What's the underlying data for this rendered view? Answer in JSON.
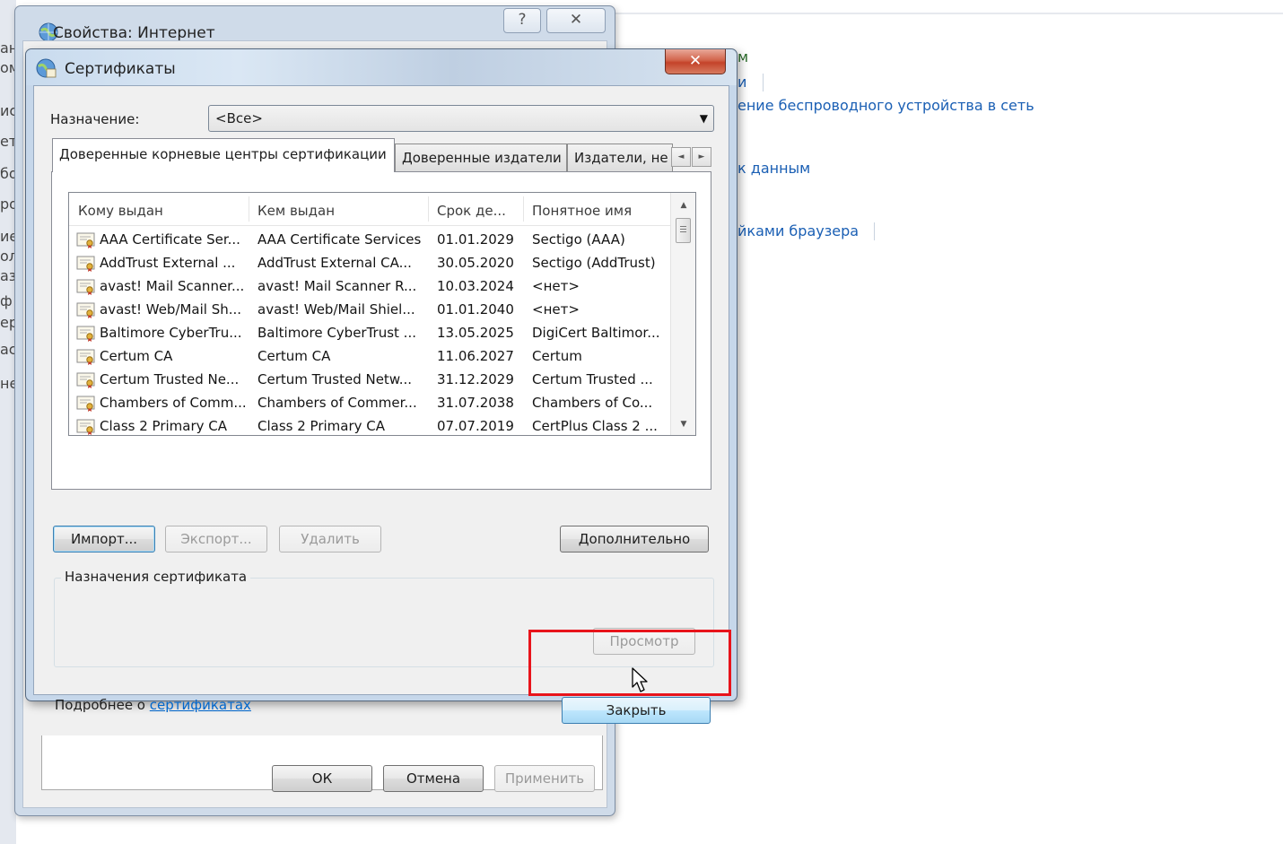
{
  "background": {
    "links": [
      "ение беспроводного устройства в сеть",
      "к данным",
      "йками браузера"
    ],
    "fragments": [
      "м",
      "и"
    ],
    "left_fragments": [
      "ан",
      "ом",
      "ис",
      "ети",
      "бо",
      "ро",
      "ие",
      "ол",
      "аз",
      "ф",
      "ерт",
      "ас",
      "не"
    ]
  },
  "internet_options": {
    "title": "Свойства: Интернет",
    "help_btn": "?",
    "close_btn": "✕",
    "buttons": {
      "ok": "ОК",
      "cancel": "Отмена",
      "apply": "Применить"
    }
  },
  "certificates_dialog": {
    "title": "Сертификаты",
    "close_btn": "✕",
    "purpose_label": "Назначение:",
    "purpose_value": "<Все>",
    "tabs": [
      "Доверенные корневые центры сертификации",
      "Доверенные издатели",
      "Издатели, не"
    ],
    "tab_scroll_left": "◄",
    "tab_scroll_right": "►",
    "columns": [
      "Кому выдан",
      "Кем выдан",
      "Срок де...",
      "Понятное имя"
    ],
    "rows": [
      [
        "AAA Certificate Ser...",
        "AAA Certificate Services",
        "01.01.2029",
        "Sectigo (AAA)"
      ],
      [
        "AddTrust External ...",
        "AddTrust External CA...",
        "30.05.2020",
        "Sectigo (AddTrust)"
      ],
      [
        "avast! Mail Scanner...",
        "avast! Mail Scanner R...",
        "10.03.2024",
        "<нет>"
      ],
      [
        "avast! Web/Mail Sh...",
        "avast! Web/Mail Shiel...",
        "01.01.2040",
        "<нет>"
      ],
      [
        "Baltimore CyberTru...",
        "Baltimore CyberTrust ...",
        "13.05.2025",
        "DigiCert Baltimor..."
      ],
      [
        "Certum CA",
        "Certum CA",
        "11.06.2027",
        "Certum"
      ],
      [
        "Certum Trusted Ne...",
        "Certum Trusted Netw...",
        "31.12.2029",
        "Certum Trusted ..."
      ],
      [
        "Chambers of Comm...",
        "Chambers of Commer...",
        "31.07.2038",
        "Chambers of Co..."
      ],
      [
        "Class 2 Primary CA",
        "Class 2 Primary CA",
        "07.07.2019",
        "CertPlus Class 2 ..."
      ]
    ],
    "buttons": {
      "import": "Импорт...",
      "export": "Экспорт...",
      "delete": "Удалить",
      "advanced": "Дополнительно",
      "view": "Просмотр",
      "close": "Закрыть"
    },
    "purposes_group": "Назначения сертификата",
    "more_info_prefix": "Подробнее о",
    "more_info_link": "сертификатах"
  },
  "colors": {
    "highlight": "#e8141b",
    "link": "#0066cc",
    "close_button": "#c4432a"
  }
}
